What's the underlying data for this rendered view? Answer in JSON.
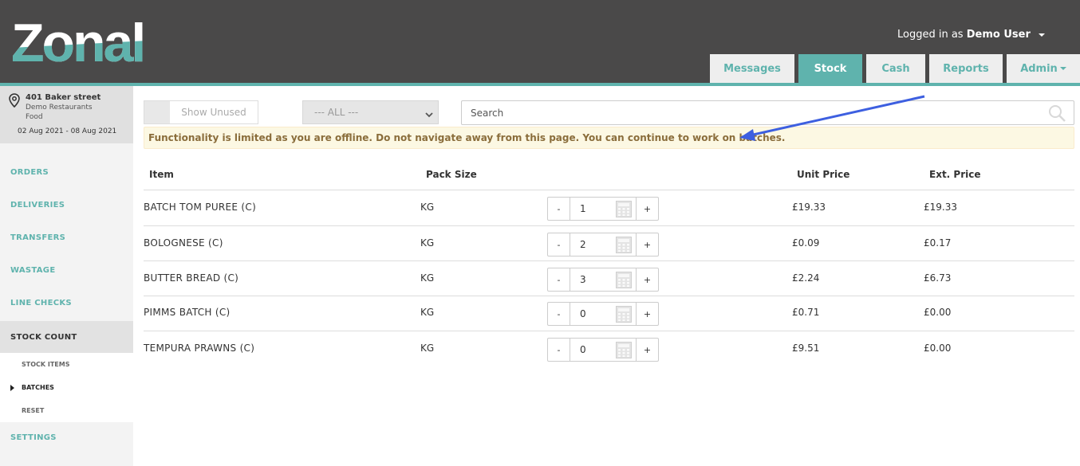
{
  "brand": {
    "logo_text": "Zonal",
    "accent": "#5fb3ad",
    "header_bg": "#4a4949"
  },
  "user": {
    "prefix": "Logged in as",
    "name": "Demo User"
  },
  "tabs": [
    {
      "label": "Messages",
      "active": false
    },
    {
      "label": "Stock",
      "active": true
    },
    {
      "label": "Cash",
      "active": false
    },
    {
      "label": "Reports",
      "active": false
    },
    {
      "label": "Admin",
      "active": false
    }
  ],
  "location": {
    "street": "401 Baker street",
    "restaurant": "Demo Restaurants",
    "type": "Food",
    "dates": "02 Aug 2021 - 08 Aug 2021",
    "icon": "map-pin-icon"
  },
  "nav": {
    "orders": "ORDERS",
    "deliveries": "DELIVERIES",
    "transfers": "TRANSFERS",
    "wastage": "WASTAGE",
    "line_checks": "LINE CHECKS",
    "stock_count": "STOCK COUNT",
    "sub": {
      "stock_items": "STOCK ITEMS",
      "batches": "BATCHES",
      "reset": "RESET"
    },
    "settings": "SETTINGS"
  },
  "filters": {
    "toggle_label": "Show Unused",
    "select_value": "--- ALL ---",
    "search_placeholder": "Search"
  },
  "notice": "Functionality is limited as you are offline. Do not navigate away from this page. You can continue to work on batches.",
  "table": {
    "headers": {
      "item": "Item",
      "pack": "Pack Size",
      "unit": "Unit Price",
      "ext": "Ext. Price"
    },
    "minus": "-",
    "plus": "+",
    "rows": [
      {
        "item": "BATCH TOM PUREE (C)",
        "pack": "KG",
        "qty": "1",
        "unit": "£19.33",
        "ext": "£19.33"
      },
      {
        "item": "BOLOGNESE (C)",
        "pack": "KG",
        "qty": "2",
        "unit": "£0.09",
        "ext": "£0.17"
      },
      {
        "item": "BUTTER BREAD (C)",
        "pack": "KG",
        "qty": "3",
        "unit": "£2.24",
        "ext": "£6.73"
      },
      {
        "item": "PIMMS BATCH (C)",
        "pack": "KG",
        "qty": "0",
        "unit": "£0.71",
        "ext": "£0.00"
      },
      {
        "item": "TEMPURA PRAWNS (C)",
        "pack": "KG",
        "qty": "0",
        "unit": "£9.51",
        "ext": "£0.00"
      }
    ]
  }
}
